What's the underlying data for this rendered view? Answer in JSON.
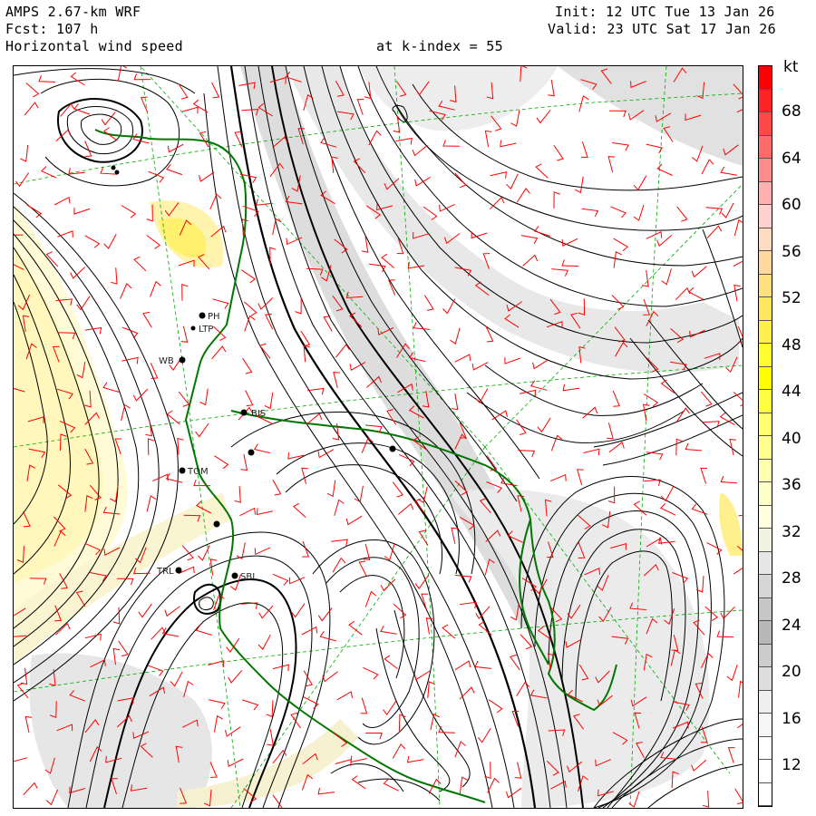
{
  "header": {
    "model": "AMPS 2.67-km WRF",
    "forecast": "Fcst: 107 h",
    "field": "Horizontal wind speed",
    "level": "at k-index = 55",
    "init": "Init: 12 UTC Tue 13 Jan 26",
    "valid": "Valid: 23 UTC Sat 17 Jan 26"
  },
  "colorbar": {
    "unit": "kt",
    "labels": [
      "68",
      "64",
      "60",
      "56",
      "52",
      "48",
      "44",
      "40",
      "36",
      "32",
      "28",
      "24",
      "20",
      "16",
      "12"
    ],
    "segments": [
      "#ff0000",
      "#ff2424",
      "#ff4848",
      "#ff6a6a",
      "#ff8c8c",
      "#ffb0b0",
      "#ffd0d0",
      "#ffdcc0",
      "#ffd8a0",
      "#ffe080",
      "#ffe860",
      "#fff050",
      "#ffff30",
      "#ffff00",
      "#ffff40",
      "#ffff70",
      "#ffff90",
      "#ffffb0",
      "#ffffc8",
      "#ffffe0",
      "#f2f2e0",
      "#e6e6e6",
      "#d6d6d6",
      "#c6c6c6",
      "#b8b8b8",
      "#cccccc",
      "#dddddd",
      "#eeeeee",
      "#f6f6f6",
      "#ffffff",
      "#ffffff",
      "#ffffff"
    ]
  },
  "stations": [
    {
      "code": "PH"
    },
    {
      "code": "LTP"
    },
    {
      "code": "WB"
    },
    {
      "code": "BIS"
    },
    {
      "code": "TOM"
    },
    {
      "code": "TRL"
    },
    {
      "code": "SBL"
    }
  ],
  "colors": {
    "coastline": "#007700",
    "barbs": "#ff0000",
    "contours": "#000000",
    "grid": "#00aa00"
  }
}
